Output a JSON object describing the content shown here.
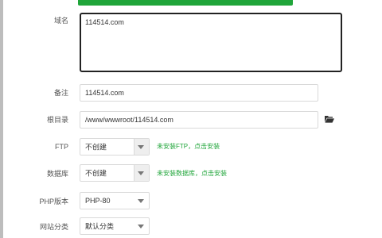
{
  "form": {
    "domain": {
      "label": "域名",
      "value": "114514.com"
    },
    "remark": {
      "label": "备注",
      "value": "114514.com"
    },
    "root_dir": {
      "label": "根目录",
      "value": "/www/wwwroot/114514.com"
    },
    "ftp": {
      "label": "FTP",
      "selected": "不创建",
      "hint": "未安装FTP，点击安装"
    },
    "database": {
      "label": "数据库",
      "selected": "不创建",
      "hint": "未安装数据库，点击安装"
    },
    "php_version": {
      "label": "PHP版本",
      "selected": "PHP-80"
    },
    "site_category": {
      "label": "网站分类",
      "selected": "默认分类"
    }
  },
  "colors": {
    "accent": "#20a53a",
    "border": "#d9d9d9",
    "focus_border": "#222222"
  },
  "icons": {
    "folder": "folder-open-icon",
    "dropdown": "chevron-down-icon"
  }
}
